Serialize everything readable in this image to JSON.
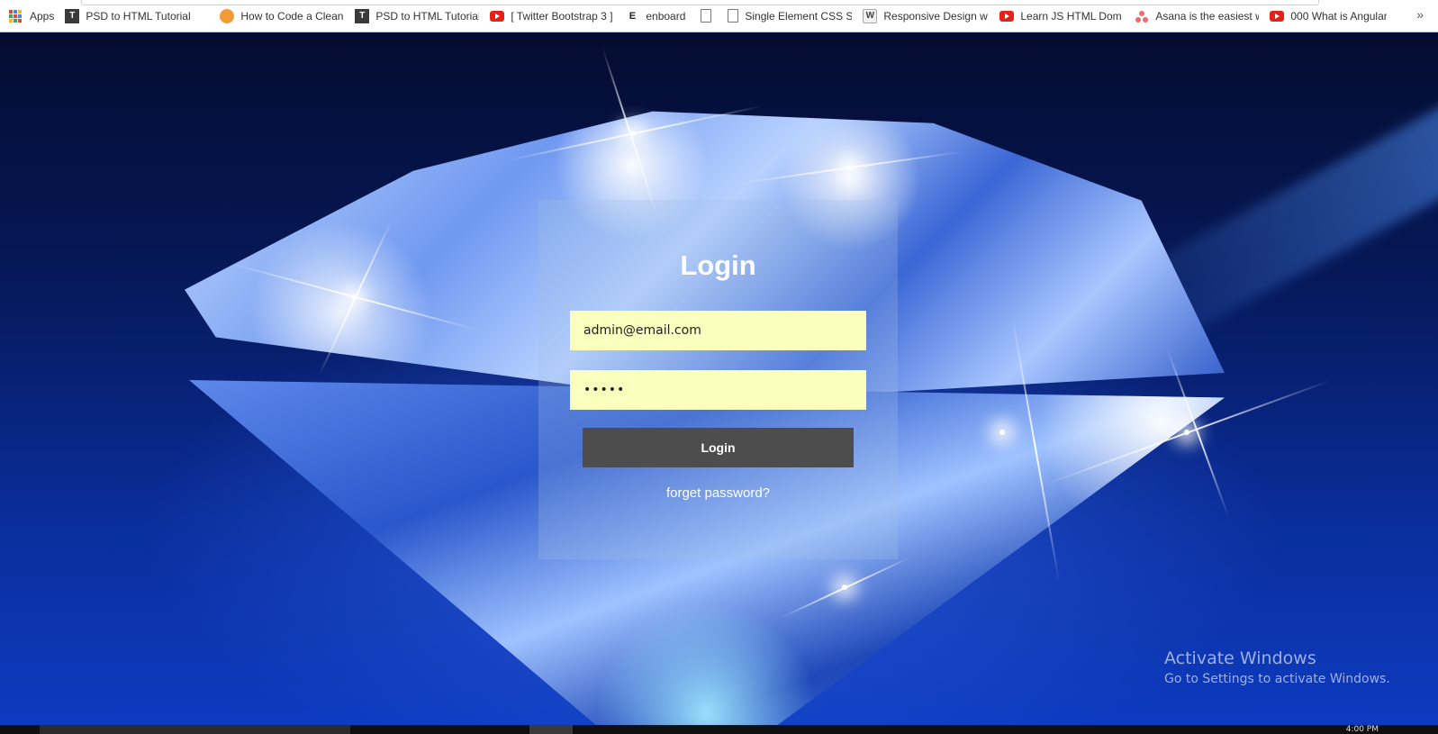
{
  "bookmarks": {
    "apps_label": "Apps",
    "items": [
      {
        "label": "PSD to HTML Tutorial",
        "icon": "tutorial-icon"
      },
      {
        "label": "How to Code a Clean",
        "icon": "orange-circle-icon"
      },
      {
        "label": "PSD to HTML Tutorial",
        "icon": "tutorial-icon"
      },
      {
        "label": "[ Twitter Bootstrap 3 ]",
        "icon": "youtube-icon"
      },
      {
        "label": "enboard",
        "icon": "letter-e-icon"
      },
      {
        "label": "",
        "icon": "document-icon"
      },
      {
        "label": "Single Element CSS S",
        "icon": "document-icon"
      },
      {
        "label": "Responsive Design w",
        "icon": "w-icon"
      },
      {
        "label": "Learn JS HTML Dom I",
        "icon": "youtube-icon"
      },
      {
        "label": "Asana is the easiest w",
        "icon": "asana-icon"
      },
      {
        "label": "000 What is Angular -",
        "icon": "youtube-icon"
      }
    ],
    "more_label": "»"
  },
  "login": {
    "title": "Login",
    "email_value": "admin@email.com",
    "password_value": "•••••",
    "button_label": "Login",
    "forget_label": "forget password?"
  },
  "watermark": {
    "line1": "Activate Windows",
    "line2": "Go to Settings to activate Windows."
  },
  "taskbar": {
    "clock": "4:00 PM"
  },
  "colors": {
    "input_bg": "#faffbd",
    "button_bg": "#4d4d4d",
    "background_deep": "#040c30",
    "background_blue": "#0d3bc0"
  }
}
